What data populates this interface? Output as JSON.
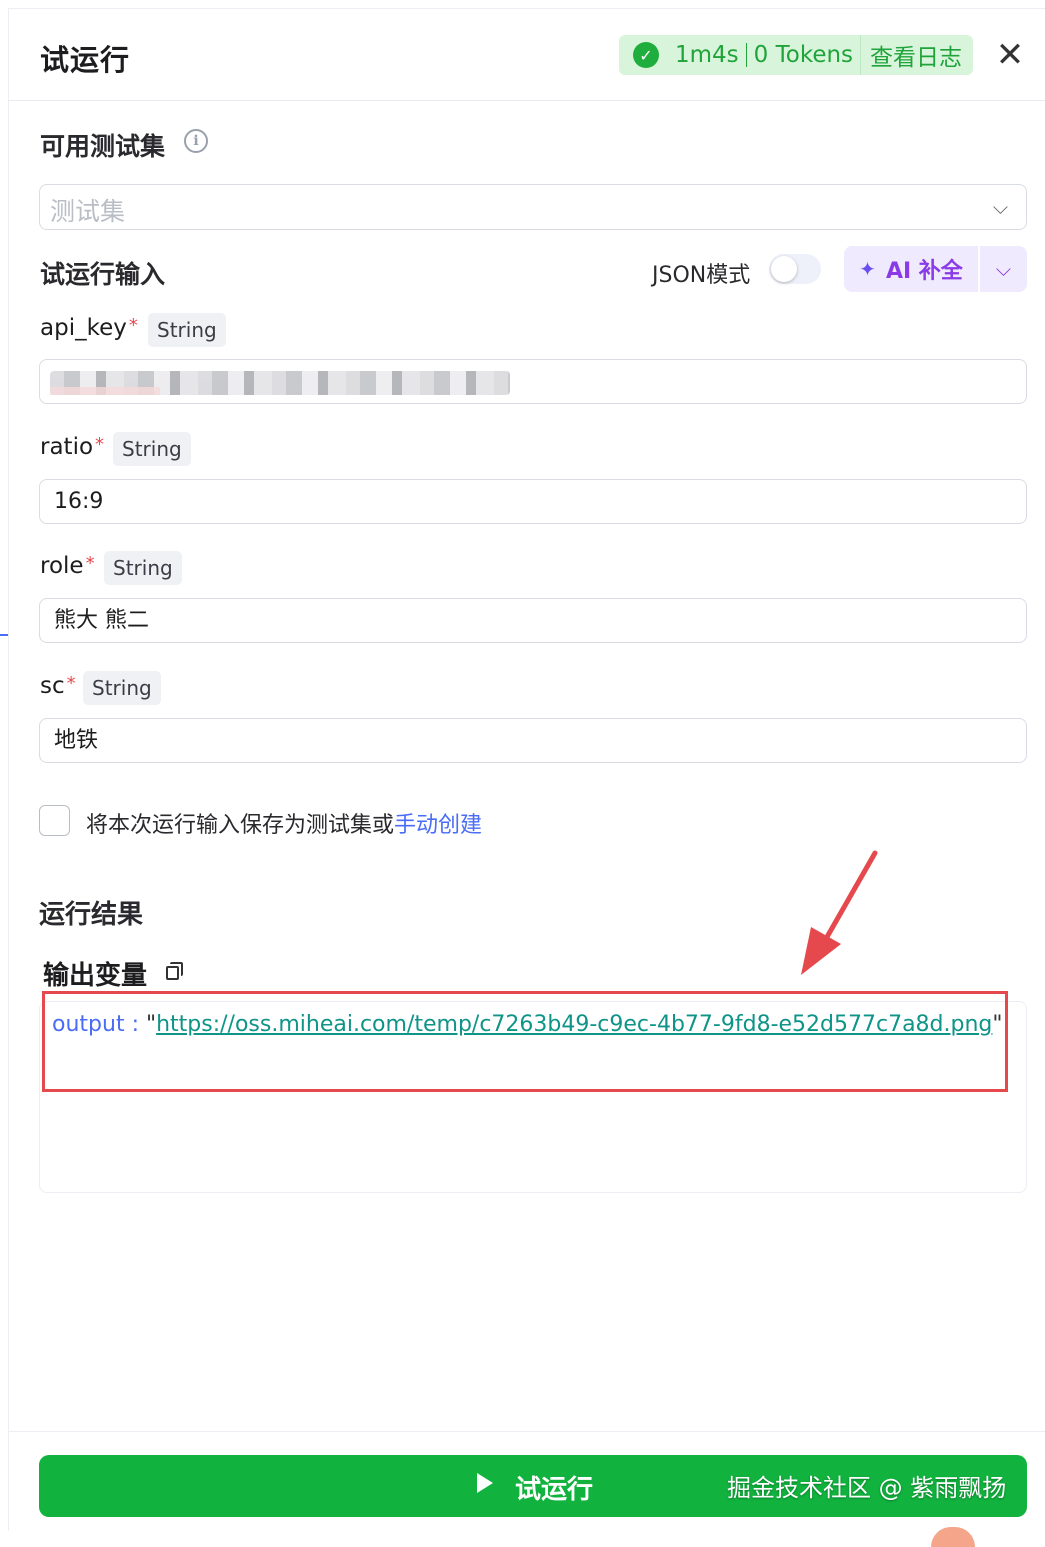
{
  "header": {
    "title": "试运行",
    "status": {
      "duration": "1m4s",
      "tokens": "0 Tokens",
      "view_log": "查看日志"
    },
    "close_icon": "close-icon"
  },
  "test_set": {
    "label": "可用测试集",
    "placeholder": "测试集"
  },
  "run_input": {
    "label": "试运行输入",
    "json_mode_label": "JSON模式",
    "json_mode_on": false,
    "ai_button_label": "AI 补全"
  },
  "fields": [
    {
      "name": "api_key",
      "type": "String",
      "value": ""
    },
    {
      "name": "ratio",
      "type": "String",
      "value": "16:9"
    },
    {
      "name": "role",
      "type": "String",
      "value": "熊大 熊二"
    },
    {
      "name": "sc",
      "type": "String",
      "value": "地铁"
    }
  ],
  "save": {
    "text": "将本次运行输入保存为测试集或",
    "link": "手动创建"
  },
  "result": {
    "title": "运行结果",
    "output_label": "输出变量",
    "output_key": "output",
    "output_url": "https://oss.miheai.com/temp/c7263b49-c9ec-4b77-9fd8-e52d577c7a8d.png"
  },
  "footer": {
    "run_label": "试运行",
    "watermark": "掘金技术社区 @ 紫雨飘扬"
  },
  "colors": {
    "primary_green": "#11b33e",
    "link_blue": "#4a6cf7",
    "highlight_red": "#e5484d"
  }
}
